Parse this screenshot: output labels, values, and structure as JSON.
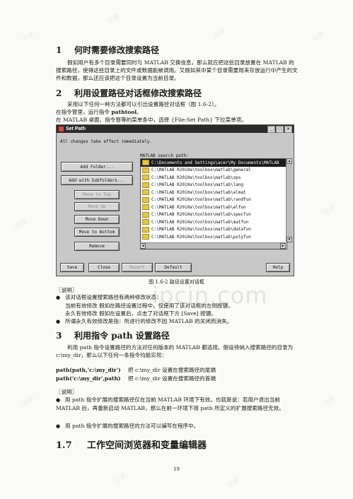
{
  "section1": {
    "num": "1",
    "title": "何时需要修改搜索路径",
    "para": "假如用户有多个目录需要同时与 MATLAB 交换信息，那么就应把这些目录放置在 MATLAB 的搜索路径，使得这些目录上的文件或数据能被调用。又假如其中某个目录需要用来存放运行中产生的文件和数据，那么还应该把这个目录设置为当前目录。"
  },
  "section2": {
    "num": "2",
    "title": "利用设置路径对话框修改搜索路径",
    "line1": "采用以下任何一种方法都可以引出设置路径对话框（图 1.6-2）。",
    "line2_pre": "在指令窗里，运行指令 ",
    "line2_cmd": "pathtool",
    "line2_post": "。",
    "line3": "在 MATLAB 桌面、指令窗等的菜单条中，选择 {File:Set Path} 下拉菜单项。"
  },
  "dialog": {
    "title": "Set Path",
    "caption": "All changes take effect immediately.",
    "search_label": "MATLAB search path:",
    "buttons": {
      "add_folder": "Add Folder...",
      "add_subfolders": "Add with Subfolders...",
      "move_top": "Move to Top",
      "move_up": "Move Up",
      "move_down": "Move Down",
      "move_bottom": "Move to Bottom",
      "remove": "Remove",
      "save": "Save",
      "close": "Close",
      "revert": "Revert",
      "default": "Default",
      "help": "Help"
    },
    "paths": [
      "C:\\Documents and Settings\\acer\\My Documents\\MATLAB",
      "C:\\MATLAB R2010a\\toolbox\\matlab\\general",
      "C:\\MATLAB R2010a\\toolbox\\matlab\\ops",
      "C:\\MATLAB R2010a\\toolbox\\matlab\\lang",
      "C:\\MATLAB R2010a\\toolbox\\matlab\\elmat",
      "C:\\MATLAB R2010a\\toolbox\\matlab\\randfun",
      "C:\\MATLAB R2010a\\toolbox\\matlab\\elfun",
      "C:\\MATLAB R2010a\\toolbox\\matlab\\specfun",
      "C:\\MATLAB R2010a\\toolbox\\matlab\\matfun",
      "C:\\MATLAB R2010a\\toolbox\\matlab\\datafun",
      "C:\\MATLAB R2010a\\toolbox\\matlab\\polyfun"
    ]
  },
  "figure_caption": "图 1.6-2   路径设置对话框",
  "note1": {
    "label": "〖说明〗",
    "b1": "该对话框设置搜索路径有两种修改状态：",
    "b1a": "当前有效修改      假如在路径设置过程中，仅使用了该对话框的左侧按键。",
    "b1b": "永久有效修改      假如在设置后，点击了对话框下方 [Save] 按键。",
    "b2": "所谓永久有效修改是指：所进行的修改不因 MATLAB 的关闭而消失。"
  },
  "section3": {
    "num": "3",
    "title_pre": "利用指令 ",
    "title_cmd": "path",
    "title_post": " 设置路径",
    "para": "利用 path 指令设置路径的方法对任何版本的 MATLAB 都适用。假设待纳入搜索路径的目录为 c:\\my_dir，那么以下任何一条指令均能实现：",
    "cmd1": "path(path,'c:\\my_dir')",
    "desc1": "把 c:\\my_dir 设置在搜索路径的尾端",
    "cmd2": "path('c:\\my_dir',path)",
    "desc2": "把 c:\\my_dir 设置在搜索路径的首端"
  },
  "note2": {
    "label": "〖说明〗",
    "b1": "用 path 指令扩展的搜索路径仅在当前 MATLAB 环境下有效。也就是说：若用户退出当前 MATLAB 后，再重新启动 MATLAB，那么在前一环境下用 path 所定义的扩展搜索路径无效。",
    "b2": "用 path 指令扩展的搜索路径的方法可以编写在程序中。"
  },
  "section17": {
    "num": "1.7",
    "title": "工作空间浏览器和变量编辑器"
  },
  "page_number": "19",
  "watermark": {
    "small": "试读",
    "big": "ipcin.com"
  }
}
